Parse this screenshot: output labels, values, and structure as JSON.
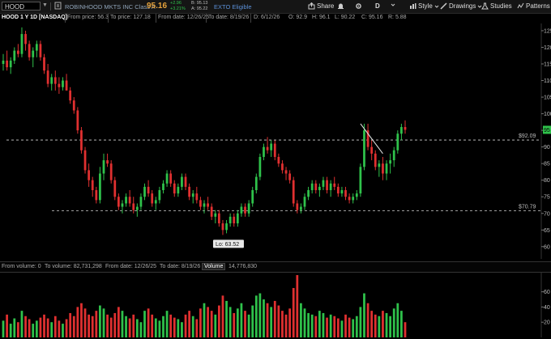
{
  "toolbar": {
    "symbol": "HOOD",
    "company": "ROBINHOOD MKTS INC Class A",
    "last_price": "95.16",
    "change_abs": "+2.96",
    "change_pct": "+3.21%",
    "bid": "B: 95.13",
    "ask": "A: 95.22",
    "exto": "EXTO Eligible",
    "share": "Share",
    "timeframe": "D",
    "style": "Style",
    "drawings": "Drawings",
    "studies": "Studies",
    "patterns": "Patterns"
  },
  "subbar": {
    "title": "HOOD 1 Y 1D [NASDAQ]",
    "from_price": "From price: 56.3",
    "to_price": "To price: 127.18",
    "from_date": "From date: 12/26/25",
    "to_date": "To date: 8/19/26",
    "d": "D: 6/12/26",
    "o": "O: 92.9",
    "h": "H: 96.1",
    "l": "L: 90.22",
    "c": "C: 95.16",
    "r": "R: 5.88"
  },
  "volume_bar": {
    "from_volume": "From volume: 0",
    "to_volume": "To volume: 82,731,298",
    "from_date": "From date: 12/26/25",
    "to_date": "To date: 8/19/26",
    "label": "Volume",
    "value": "14,776,830"
  },
  "chart_data": {
    "type": "candlestick",
    "price_axis": {
      "min": 56.3,
      "max": 127.18,
      "ticks": [
        "60",
        "65",
        "70",
        "75",
        "80",
        "85",
        "90",
        "95",
        "100",
        "105",
        "110",
        "115",
        "120",
        "125"
      ],
      "tick_values": [
        60,
        65,
        70,
        75,
        80,
        85,
        90,
        95,
        100,
        105,
        110,
        115,
        120,
        125
      ]
    },
    "volume_axis": {
      "ticks": [
        "20",
        "40",
        "60"
      ],
      "tick_values": [
        20,
        40,
        60
      ]
    },
    "levels": [
      {
        "label": "$92.09",
        "value": 92.09
      },
      {
        "label": "$70.79",
        "value": 70.79
      }
    ],
    "low_label": {
      "text": "Lo: 63.52",
      "value": 63.52
    },
    "last_price_badge": {
      "text": "95",
      "value": 95.16
    },
    "up_color": "#2fc24b",
    "down_color": "#e03030",
    "trendline": {
      "from": 97,
      "to": 88
    },
    "candles": [
      [
        115,
        118,
        113,
        116
      ],
      [
        116,
        119,
        113,
        114
      ],
      [
        114,
        117,
        112,
        116
      ],
      [
        116,
        120,
        115,
        119
      ],
      [
        119,
        121,
        117,
        118
      ],
      [
        118,
        126,
        117,
        124
      ],
      [
        124,
        125,
        119,
        121
      ],
      [
        121,
        122,
        116,
        117
      ],
      [
        117,
        120,
        114,
        119
      ],
      [
        119,
        122,
        117,
        121
      ],
      [
        121,
        122,
        116,
        117
      ],
      [
        117,
        118,
        112,
        113
      ],
      [
        113,
        115,
        108,
        109
      ],
      [
        109,
        112,
        107,
        111
      ],
      [
        111,
        113,
        107,
        109
      ],
      [
        109,
        111,
        106,
        108
      ],
      [
        108,
        111,
        107,
        110
      ],
      [
        110,
        112,
        107,
        107
      ],
      [
        107,
        108,
        103,
        104
      ],
      [
        104,
        105,
        100,
        101
      ],
      [
        101,
        102,
        94,
        95
      ],
      [
        95,
        96,
        88,
        89
      ],
      [
        89,
        90,
        82,
        83
      ],
      [
        83,
        85,
        78,
        80
      ],
      [
        80,
        81,
        75,
        77
      ],
      [
        77,
        78,
        73,
        74
      ],
      [
        74,
        84,
        73,
        82
      ],
      [
        82,
        88,
        80,
        86
      ],
      [
        86,
        88,
        84,
        85
      ],
      [
        85,
        86,
        79,
        80
      ],
      [
        80,
        81,
        74,
        75
      ],
      [
        75,
        76,
        71,
        72
      ],
      [
        72,
        74,
        70,
        73
      ],
      [
        73,
        76,
        72,
        75
      ],
      [
        75,
        77,
        72,
        73
      ],
      [
        73,
        75,
        70,
        71
      ],
      [
        71,
        73,
        69,
        72
      ],
      [
        72,
        76,
        71,
        75
      ],
      [
        75,
        79,
        74,
        78
      ],
      [
        78,
        80,
        75,
        76
      ],
      [
        76,
        77,
        72,
        73
      ],
      [
        73,
        75,
        71,
        74
      ],
      [
        74,
        78,
        73,
        77
      ],
      [
        77,
        80,
        76,
        79
      ],
      [
        79,
        83,
        78,
        82
      ],
      [
        82,
        83,
        78,
        79
      ],
      [
        79,
        80,
        75,
        76
      ],
      [
        76,
        79,
        75,
        78
      ],
      [
        78,
        82,
        77,
        81
      ],
      [
        81,
        82,
        77,
        78
      ],
      [
        78,
        79,
        74,
        75
      ],
      [
        75,
        77,
        73,
        76
      ],
      [
        76,
        78,
        73,
        74
      ],
      [
        74,
        75,
        71,
        72
      ],
      [
        72,
        74,
        70,
        73
      ],
      [
        73,
        75,
        71,
        72
      ],
      [
        72,
        73,
        68,
        69
      ],
      [
        69,
        71,
        67,
        70
      ],
      [
        70,
        71,
        66,
        67
      ],
      [
        67,
        68,
        63.52,
        65
      ],
      [
        65,
        68,
        64,
        67
      ],
      [
        67,
        70,
        66,
        69
      ],
      [
        69,
        70,
        66,
        67
      ],
      [
        67,
        71,
        66,
        70
      ],
      [
        70,
        73,
        69,
        72
      ],
      [
        72,
        73,
        69,
        70
      ],
      [
        70,
        74,
        69,
        73
      ],
      [
        73,
        78,
        72,
        77
      ],
      [
        77,
        82,
        76,
        81
      ],
      [
        81,
        88,
        80,
        87
      ],
      [
        87,
        91,
        86,
        90
      ],
      [
        90,
        93,
        88,
        89
      ],
      [
        89,
        92,
        87,
        91
      ],
      [
        91,
        92,
        86,
        87
      ],
      [
        87,
        88,
        84,
        85
      ],
      [
        85,
        86,
        82,
        83
      ],
      [
        83,
        84,
        80,
        82
      ],
      [
        82,
        83,
        79,
        80
      ],
      [
        80,
        81,
        72,
        73
      ],
      [
        73,
        74,
        70,
        71
      ],
      [
        71,
        73,
        70,
        72
      ],
      [
        72,
        76,
        71,
        75
      ],
      [
        75,
        78,
        74,
        77
      ],
      [
        77,
        80,
        76,
        79
      ],
      [
        79,
        80,
        76,
        77
      ],
      [
        77,
        79,
        75,
        78
      ],
      [
        78,
        81,
        77,
        80
      ],
      [
        80,
        81,
        76,
        77
      ],
      [
        77,
        80,
        75,
        79
      ],
      [
        79,
        81,
        77,
        78
      ],
      [
        78,
        79,
        75,
        76
      ],
      [
        76,
        78,
        75,
        77
      ],
      [
        77,
        78,
        74,
        75
      ],
      [
        75,
        76,
        73,
        74
      ],
      [
        74,
        76,
        73,
        75
      ],
      [
        75,
        77,
        74,
        76
      ],
      [
        76,
        85,
        75,
        84
      ],
      [
        84,
        97,
        83,
        95
      ],
      [
        95,
        97,
        89,
        90
      ],
      [
        90,
        92,
        86,
        88
      ],
      [
        88,
        89,
        83,
        84
      ],
      [
        84,
        86,
        81,
        85
      ],
      [
        85,
        87,
        80,
        82
      ],
      [
        82,
        86,
        80,
        85
      ],
      [
        85,
        88,
        82,
        86
      ],
      [
        86,
        90,
        84,
        89
      ],
      [
        89,
        95,
        88,
        94
      ],
      [
        94,
        97,
        92,
        96
      ],
      [
        96,
        98,
        94,
        95.16
      ]
    ],
    "volumes": [
      22,
      30,
      18,
      25,
      20,
      35,
      28,
      24,
      18,
      22,
      26,
      30,
      25,
      20,
      28,
      22,
      18,
      24,
      32,
      28,
      40,
      45,
      38,
      30,
      28,
      35,
      42,
      38,
      30,
      26,
      32,
      40,
      35,
      28,
      25,
      30,
      24,
      20,
      35,
      38,
      30,
      25,
      22,
      28,
      35,
      30,
      26,
      24,
      20,
      30,
      35,
      28,
      24,
      38,
      45,
      40,
      35,
      30,
      42,
      55,
      48,
      40,
      32,
      38,
      45,
      35,
      30,
      42,
      55,
      58,
      50,
      45,
      40,
      48,
      42,
      35,
      30,
      38,
      65,
      82,
      45,
      38,
      32,
      30,
      28,
      35,
      32,
      26,
      30,
      28,
      25,
      22,
      30,
      26,
      24,
      28,
      40,
      58,
      45,
      35,
      30,
      28,
      35,
      32,
      28,
      38,
      45,
      35,
      20
    ]
  }
}
